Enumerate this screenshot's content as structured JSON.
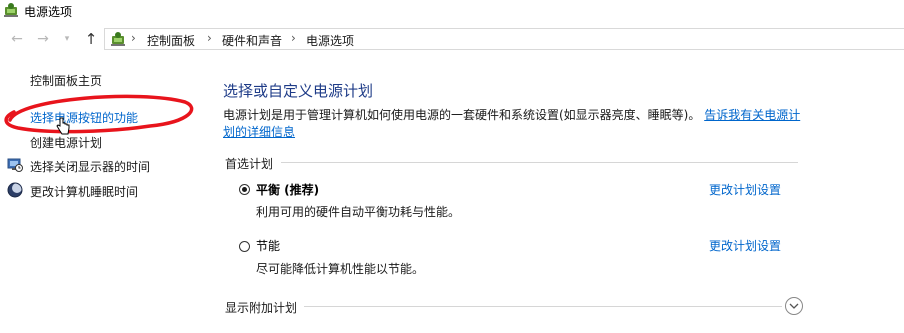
{
  "window": {
    "title": "电源选项",
    "app_icon": "power-options-icon"
  },
  "nav": {
    "back_glyph": "←",
    "forward_glyph": "→",
    "dropdown_glyph": "▾",
    "up_glyph": "↑",
    "breadcrumbs": [
      "控制面板",
      "硬件和声音",
      "电源选项"
    ],
    "separator": "›"
  },
  "sidebar": {
    "home": "控制面板主页",
    "items": [
      {
        "label": "选择电源按钮的功能",
        "icon": null
      },
      {
        "label": "创建电源计划",
        "icon": null
      },
      {
        "label": "选择关闭显示器的时间",
        "icon": "display-timer-icon"
      },
      {
        "label": "更改计算机睡眠时间",
        "icon": "sleep-moon-icon"
      }
    ]
  },
  "main": {
    "title": "选择或自定义电源计划",
    "description": "电源计划是用于管理计算机如何使用电源的一套硬件和系统设置(如显示器亮度、睡眠等)。",
    "description_link": "告诉我有关电源计划的详细信息",
    "preferred_header": "首选计划",
    "plans": [
      {
        "name": "平衡 (推荐)",
        "description": "利用可用的硬件自动平衡功耗与性能。",
        "selected": true,
        "link": "更改计划设置"
      },
      {
        "name": "节能",
        "description": "尽可能降低计算机性能以节能。",
        "selected": false,
        "link": "更改计划设置"
      }
    ],
    "additional_header": "显示附加计划"
  },
  "colors": {
    "link": "#0066cc",
    "title": "#1f3c88",
    "annotation": "#e8141c"
  }
}
